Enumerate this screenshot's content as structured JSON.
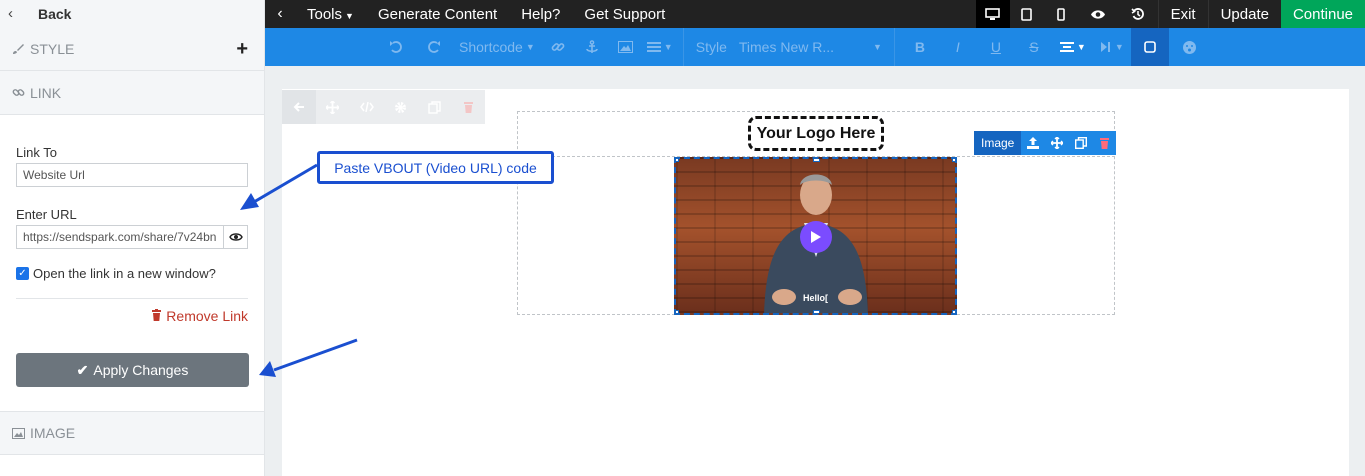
{
  "sidebar": {
    "back_label": "Back",
    "style_label": "STYLE",
    "link_label": "LINK",
    "link_to_label": "Link To",
    "link_to_value": "Website Url",
    "enter_url_label": "Enter URL",
    "url_value": "https://sendspark.com/share/7v24bn",
    "open_new_window_label": "Open the link in a new window?",
    "open_new_window_checked": true,
    "remove_link_label": "Remove Link",
    "apply_changes_label": "Apply Changes",
    "image_label": "IMAGE"
  },
  "topbar": {
    "tools_label": "Tools",
    "generate_label": "Generate Content",
    "help_label": "Help?",
    "support_label": "Get Support",
    "exit_label": "Exit",
    "update_label": "Update",
    "continue_label": "Continue"
  },
  "toolbar": {
    "shortcode_label": "Shortcode",
    "style_label": "Style",
    "font_label": "Times New R..."
  },
  "canvas": {
    "logo_text": "Your Logo Here",
    "image_tools_label": "Image",
    "video_overlay_text": "Hello["
  },
  "annotation": {
    "callout_text": "Paste VBOUT (Video URL) code"
  },
  "colors": {
    "topbar": "#222222",
    "toolbar": "#1e88e5",
    "continue": "#00a65a",
    "apply_button": "#6c757d",
    "remove_link": "#c0392b",
    "annotation": "#1a4fd0"
  }
}
